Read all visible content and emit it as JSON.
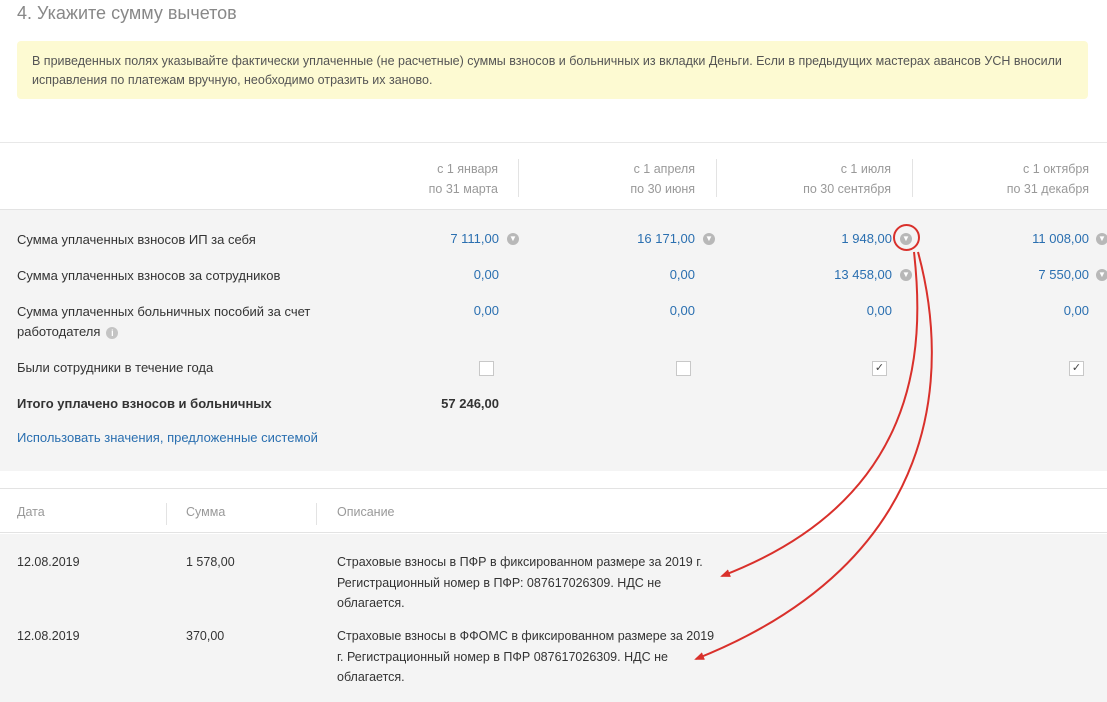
{
  "step_title": "4. Укажите сумму вычетов",
  "notice": "В приведенных полях указывайте фактически уплаченные (не расчетные) суммы взносов и больничных из вкладки Деньги. Если в предыдущих мастерах авансов УСН вносили исправления по платежам вручную, необходимо отразить их заново.",
  "periods": [
    {
      "line1": "с 1 января",
      "line2": "по 31 марта"
    },
    {
      "line1": "с 1 апреля",
      "line2": "по 30 июня"
    },
    {
      "line1": "с 1 июля",
      "line2": "по 30 сентября"
    },
    {
      "line1": "с 1 октября",
      "line2": "по 31 декабря"
    }
  ],
  "rows": {
    "own_contrib": {
      "label": "Сумма уплаченных взносов ИП за себя",
      "values": [
        "7 111,00",
        "16 171,00",
        "1 948,00",
        "11 008,00"
      ]
    },
    "staff_contrib": {
      "label": "Сумма уплаченных взносов за сотрудников",
      "values": [
        "0,00",
        "0,00",
        "13 458,00",
        "7 550,00"
      ]
    },
    "sick_pay": {
      "label_line1": "Сумма уплаченных больничных пособий за счет",
      "label_line2": "работодателя",
      "values": [
        "0,00",
        "0,00",
        "0,00",
        "0,00"
      ]
    },
    "had_staff": {
      "label": "Были сотрудники в течение года",
      "checked": [
        false,
        false,
        true,
        true
      ]
    },
    "total": {
      "label": "Итого уплачено взносов и больничных",
      "value": "57 246,00"
    }
  },
  "icons": {
    "dropdown": "chevron-down-icon",
    "info": "info-icon",
    "check": "checkmark-icon"
  },
  "system_link": "Использовать значения, предложенные системой",
  "payments_table": {
    "headers": [
      "Дата",
      "Сумма",
      "Описание"
    ],
    "rows": [
      {
        "date": "12.08.2019",
        "amount": "1 578,00",
        "desc": [
          "Страховые взносы в ПФР в фиксированном размере за 2019 г.",
          "Регистрационный номер в ПФР: 087617026309. НДС не",
          "облагается."
        ]
      },
      {
        "date": "12.08.2019",
        "amount": "370,00",
        "desc": [
          "Страховые взносы в ФФОМС в фиксированном размере за 2019",
          "г. Регистрационный номер в ПФР 087617026309. НДС не",
          "облагается."
        ]
      }
    ]
  },
  "colors": {
    "link": "#2a6fb0",
    "annotation": "#d9302b",
    "notice_bg": "#fdfad2"
  }
}
